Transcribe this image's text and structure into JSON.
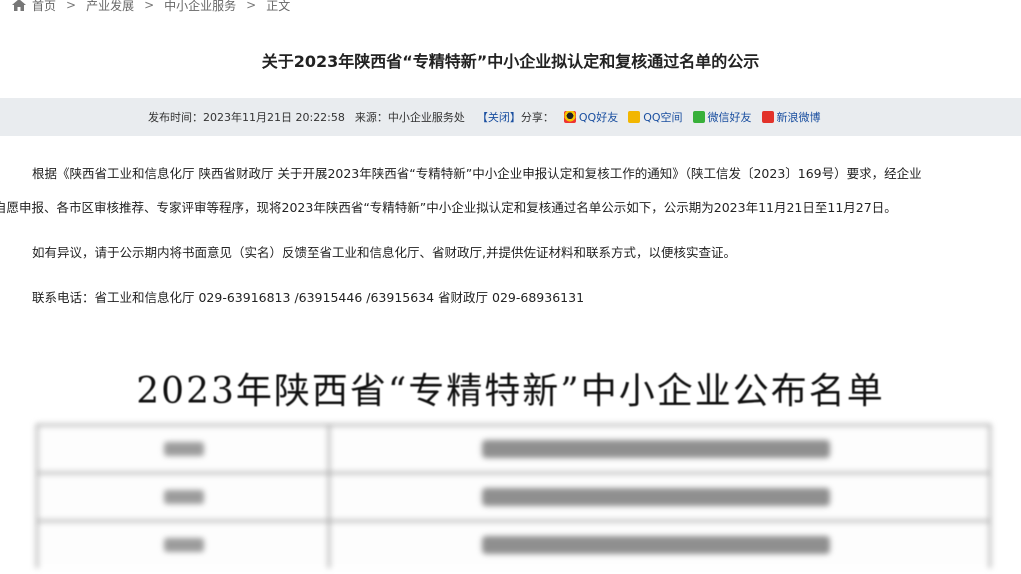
{
  "breadcrumb": {
    "items": [
      "首页",
      "产业发展",
      "中小企业服务",
      "正文"
    ],
    "separator": ">"
  },
  "article": {
    "title": "关于2023年陕西省“专精特新”中小企业拟认定和复核通过名单的公示"
  },
  "meta": {
    "publish_label": "发布时间：",
    "publish_time": "2023年11月21日 20:22:58",
    "source_label": "来源：",
    "source": "中小企业服务处",
    "close": "【关闭】",
    "share_label": "分享：",
    "share": [
      {
        "label": "QQ好友",
        "icon": "qq-icon"
      },
      {
        "label": "QQ空间",
        "icon": "qzone-icon"
      },
      {
        "label": "微信好友",
        "icon": "wechat-icon"
      },
      {
        "label": "新浪微博",
        "icon": "weibo-icon"
      }
    ]
  },
  "body": {
    "p1_line1": "根据《陕西省工业和信息化厅 陕西省财政厅 关于开展2023年陕西省“专精特新”中小企业申报认定和复核工作的通知》（陕工信发〔2023〕169号）要求，经企业",
    "p1_line2": "自愿申报、各市区审核推荐、专家评审等程序，现将2023年陕西省“专精特新”中小企业拟认定和复核通过名单公示如下，公示期为2023年11月21日至11月27日。",
    "p2": "如有异议，请于公示期内将书面意见（实名）反馈至省工业和信息化厅、省财政厅,并提供佐证材料和联系方式，以便核实查证。",
    "p3": "联系电话：省工业和信息化厅  029-63916813 /63915446 /63915634   省财政厅  029-68936131"
  },
  "embedded_image": {
    "heading": "2023年陕西省“专精特新”中小企业公布名单",
    "rows_visible": 3
  }
}
